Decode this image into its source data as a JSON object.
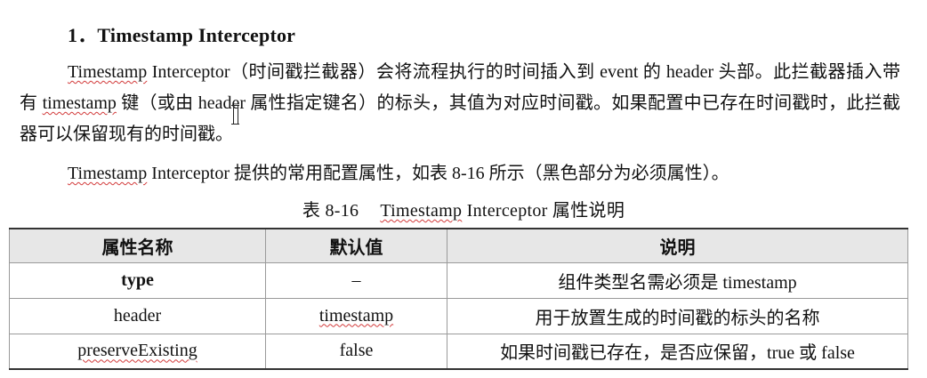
{
  "document": {
    "heading": "1．Timestamp Interceptor",
    "paragraph1": {
      "term": "Timestamp",
      "p1": " Interceptor（时间戳拦截器）会将流程执行的时间插入到 event 的 header 头部。此拦截器插入带有 ",
      "term2": "timestamp",
      "p2": " 键（或由 header 属性指定键名）的标头，其值为对应时间戳。如果配置中已存在时间戳时，此拦截器可以保留现有的时间戳。"
    },
    "paragraph2": {
      "term": "Timestamp",
      "text": " Interceptor 提供的常用配置属性，如表 8-16 所示（黑色部分为必须属性）。"
    },
    "caption": {
      "number": "表 8-16",
      "term": "Timestamp",
      "text": " Interceptor 属性说明"
    },
    "table": {
      "headers": [
        "属性名称",
        "默认值",
        "说明"
      ],
      "rows": [
        [
          "type",
          "–",
          "组件类型名需必须是 timestamp"
        ],
        [
          "header",
          "timestamp",
          "用于放置生成的时间戳的标头的名称"
        ],
        [
          "preserveExisting",
          "false",
          "如果时间戳已存在，是否应保留，true 或 false"
        ]
      ]
    }
  },
  "cursor_icon": "text-cursor-icon"
}
